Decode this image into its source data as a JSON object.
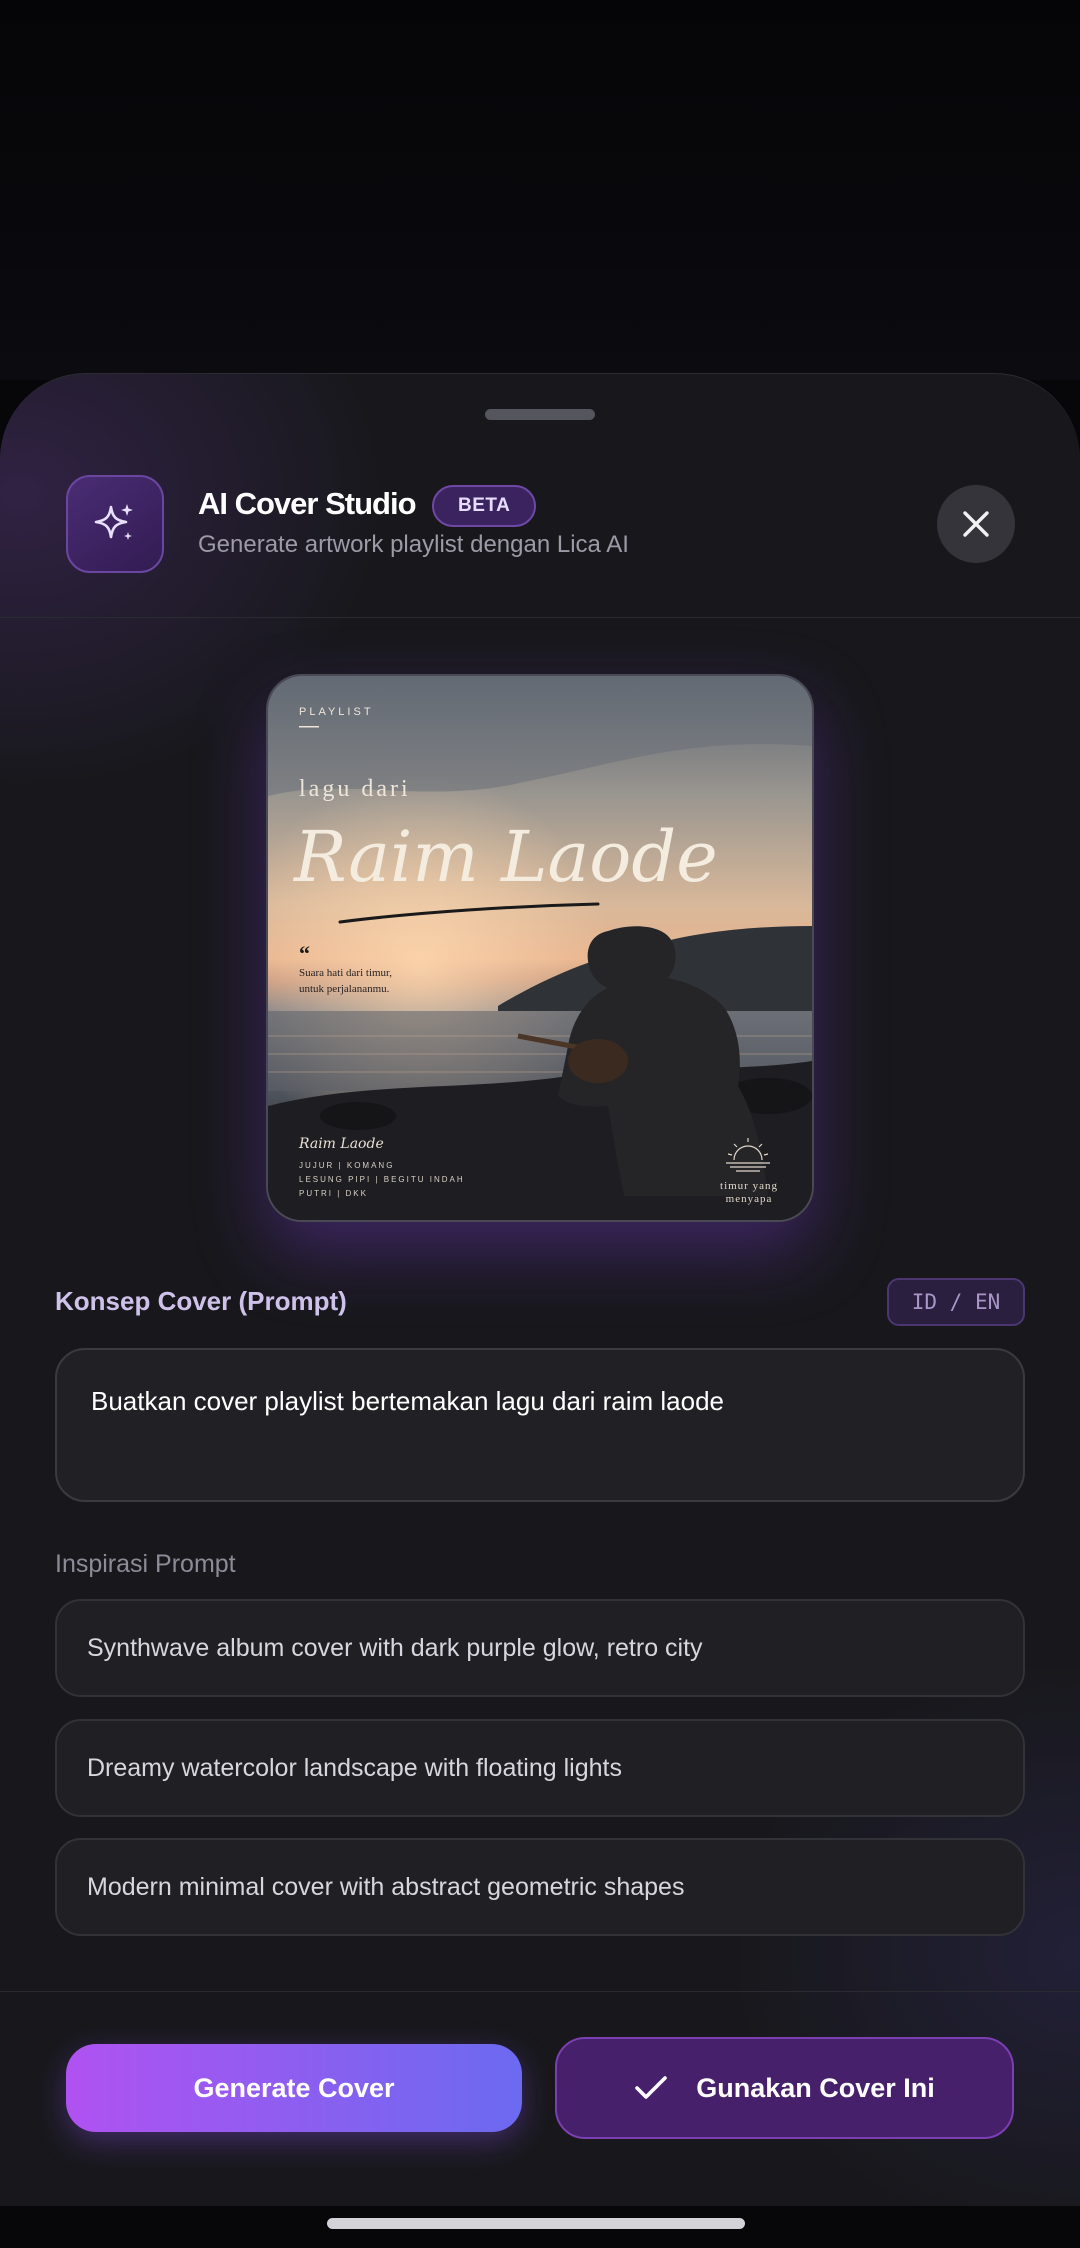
{
  "header": {
    "title": "AI Cover Studio",
    "badge": "BETA",
    "subtitle": "Generate artwork playlist dengan Lica AI",
    "icon": "sparkles-icon",
    "close_icon": "close-icon"
  },
  "cover": {
    "kicker": "PLAYLIST",
    "pre_title": "lagu dari",
    "title": "Raim Laode",
    "quote_mark": "“",
    "quote_line1": "Suara hati dari timur,",
    "quote_line2": "untuk perjalananmu.",
    "signature": "Raim Laode",
    "tracks_line1": "JUJUR | KOMANG",
    "tracks_line2": "LESUNG PIPI | BEGITU INDAH",
    "tracks_line3": "PUTRI | DKK",
    "emblem_line1": "timur yang",
    "emblem_line2": "menyapa"
  },
  "prompt": {
    "label": "Konsep Cover (Prompt)",
    "lang_toggle": "ID / EN",
    "value": "Buatkan cover playlist bertemakan lagu dari raim laode"
  },
  "inspirations": {
    "label": "Inspirasi Prompt",
    "items": [
      "Synthwave album cover with dark purple glow, retro city",
      "Dreamy watercolor landscape with floating lights",
      "Modern minimal cover with abstract geometric shapes"
    ]
  },
  "actions": {
    "generate_label": "Generate Cover",
    "use_label": "Gunakan Cover Ini",
    "use_icon": "check-icon"
  },
  "colors": {
    "accent_start": "#b052f1",
    "accent_end": "#6b6af0",
    "sheet_bg": "#18181c",
    "badge_bg": "#3b2360"
  }
}
